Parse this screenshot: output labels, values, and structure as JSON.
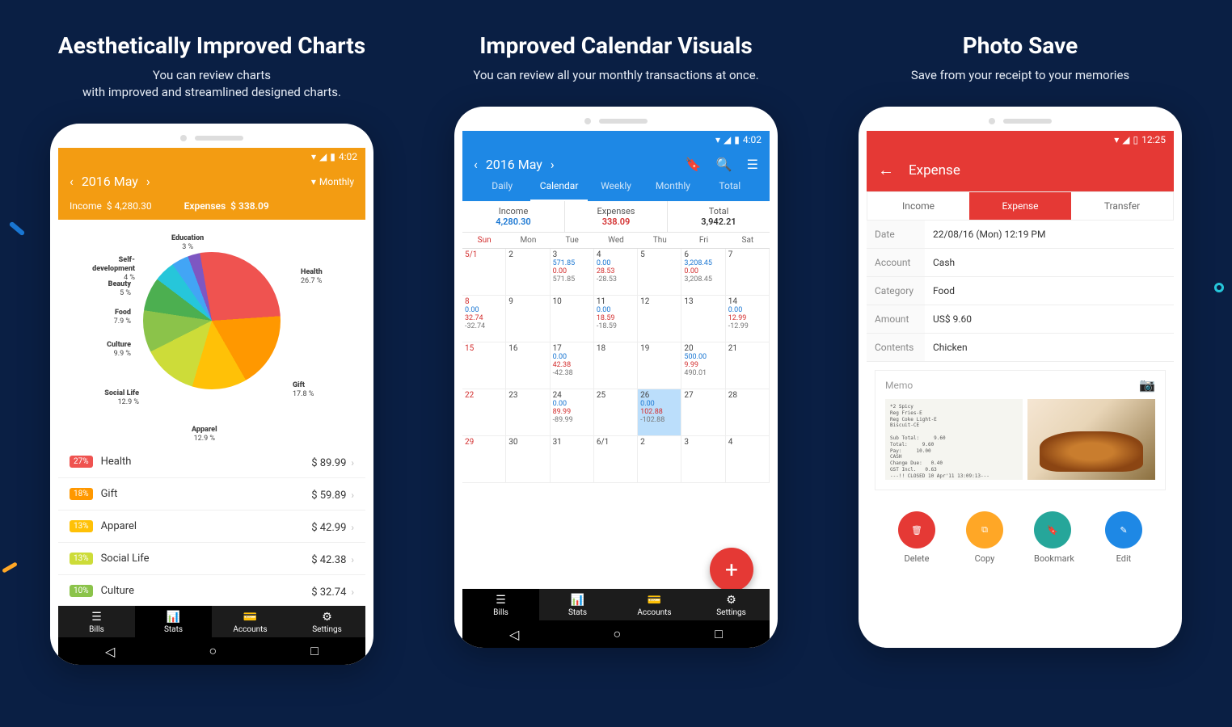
{
  "card1": {
    "title": "Aesthetically Improved Charts",
    "sub": "You can review charts\nwith improved and streamlined designed charts.",
    "status_time": "4:02",
    "date": "2016 May",
    "period": "Monthly",
    "income_label": "Income",
    "income": "$ 4,280.30",
    "expense_label": "Expenses",
    "expense": "$ 338.09",
    "list": [
      {
        "pct": "27%",
        "color": "#ef5350",
        "name": "Health",
        "amt": "$ 89.99"
      },
      {
        "pct": "18%",
        "color": "#ff9800",
        "name": "Gift",
        "amt": "$ 59.89"
      },
      {
        "pct": "13%",
        "color": "#ffc107",
        "name": "Apparel",
        "amt": "$ 42.99"
      },
      {
        "pct": "13%",
        "color": "#cddc39",
        "name": "Social Life",
        "amt": "$ 42.38"
      },
      {
        "pct": "10%",
        "color": "#8bc34a",
        "name": "Culture",
        "amt": "$ 32.74"
      }
    ],
    "nav": [
      "Bills",
      "Stats",
      "Accounts",
      "Settings"
    ]
  },
  "chart_data": {
    "type": "pie",
    "title": "",
    "series": [
      {
        "name": "Health",
        "value": 26.7,
        "color": "#ef5350"
      },
      {
        "name": "Gift",
        "value": 17.8,
        "color": "#ff9800"
      },
      {
        "name": "Apparel",
        "value": 12.9,
        "color": "#ffc107"
      },
      {
        "name": "Social Life",
        "value": 12.9,
        "color": "#cddc39"
      },
      {
        "name": "Culture",
        "value": 9.9,
        "color": "#8bc34a"
      },
      {
        "name": "Food",
        "value": 7.9,
        "color": "#4caf50"
      },
      {
        "name": "Beauty",
        "value": 5.0,
        "color": "#26c6da"
      },
      {
        "name": "Self-development",
        "value": 4.0,
        "color": "#42a5f5"
      },
      {
        "name": "Education",
        "value": 3.0,
        "color": "#7e57c2"
      }
    ]
  },
  "card2": {
    "title": "Improved Calendar Visuals",
    "sub": "You can review all your monthly transactions at once.",
    "status_time": "4:02",
    "date": "2016 May",
    "tabs": [
      "Daily",
      "Calendar",
      "Weekly",
      "Monthly",
      "Total"
    ],
    "summary": {
      "inc_l": "Income",
      "inc": "4,280.30",
      "exp_l": "Expenses",
      "exp": "338.09",
      "tot_l": "Total",
      "tot": "3,942.21"
    },
    "days": [
      "Sun",
      "Mon",
      "Tue",
      "Wed",
      "Thu",
      "Fri",
      "Sat"
    ],
    "cells": [
      {
        "d": "5/1",
        "sun": true
      },
      {
        "d": "2"
      },
      {
        "d": "3",
        "inc": "571.85",
        "exp": "0.00",
        "bal": "571.85"
      },
      {
        "d": "4",
        "inc": "0.00",
        "exp": "28.53",
        "bal": "-28.53"
      },
      {
        "d": "5"
      },
      {
        "d": "6",
        "inc": "3,208.45",
        "exp": "0.00",
        "bal": "3,208.45"
      },
      {
        "d": "7"
      },
      {
        "d": "8",
        "sun": true,
        "inc": "0.00",
        "exp": "32.74",
        "bal": "-32.74"
      },
      {
        "d": "9"
      },
      {
        "d": "10"
      },
      {
        "d": "11",
        "inc": "0.00",
        "exp": "18.59",
        "bal": "-18.59"
      },
      {
        "d": "12"
      },
      {
        "d": "13"
      },
      {
        "d": "14",
        "inc": "0.00",
        "exp": "12.99",
        "bal": "-12.99"
      },
      {
        "d": "15",
        "sun": true
      },
      {
        "d": "16"
      },
      {
        "d": "17",
        "inc": "0.00",
        "exp": "42.38",
        "bal": "-42.38"
      },
      {
        "d": "18"
      },
      {
        "d": "19"
      },
      {
        "d": "20",
        "inc": "500.00",
        "exp": "9.99",
        "bal": "490.01"
      },
      {
        "d": "21"
      },
      {
        "d": "22",
        "sun": true
      },
      {
        "d": "23"
      },
      {
        "d": "24",
        "inc": "0.00",
        "exp": "89.99",
        "bal": "-89.99"
      },
      {
        "d": "25"
      },
      {
        "d": "26",
        "sel": true,
        "inc": "0.00",
        "exp": "102.88",
        "bal": "-102.88"
      },
      {
        "d": "27"
      },
      {
        "d": "28"
      },
      {
        "d": "29",
        "sun": true
      },
      {
        "d": "30"
      },
      {
        "d": "31"
      },
      {
        "d": "6/1"
      },
      {
        "d": "2"
      },
      {
        "d": "3"
      },
      {
        "d": "4"
      }
    ],
    "nav": [
      "Bills",
      "Stats",
      "Accounts",
      "Settings"
    ]
  },
  "card3": {
    "title": "Photo Save",
    "sub": "Save from your receipt to your memories",
    "status_time": "12:25",
    "header": "Expense",
    "type_tabs": [
      "Income",
      "Expense",
      "Transfer"
    ],
    "fields": [
      {
        "l": "Date",
        "v": "22/08/16 (Mon)   12:19 PM"
      },
      {
        "l": "Account",
        "v": "Cash"
      },
      {
        "l": "Category",
        "v": "Food"
      },
      {
        "l": "Amount",
        "v": "US$ 9.60"
      },
      {
        "l": "Contents",
        "v": "Chicken"
      }
    ],
    "memo": "Memo",
    "actions": [
      {
        "l": "Delete",
        "c": "#e53935",
        "icon": "trash"
      },
      {
        "l": "Copy",
        "c": "#ffa726",
        "icon": "copy"
      },
      {
        "l": "Bookmark",
        "c": "#26a69a",
        "icon": "bookmark"
      },
      {
        "l": "Edit",
        "c": "#1e88e5",
        "icon": "edit"
      }
    ]
  }
}
